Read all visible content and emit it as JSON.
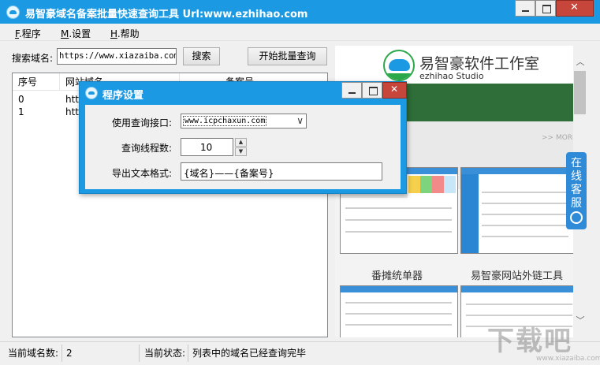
{
  "window": {
    "title": "易智豪域名备案批量快速查询工具 Url:www.ezhihao.com"
  },
  "menu": {
    "items": [
      {
        "key": "F",
        "label": ".程序"
      },
      {
        "key": "M",
        "label": ".设置"
      },
      {
        "key": "H",
        "label": ".帮助"
      }
    ]
  },
  "search": {
    "label": "搜索域名:",
    "value": "https://www.xiazaiba.com/",
    "search_button": "搜索",
    "batch_button": "开始批量查询"
  },
  "table": {
    "columns": [
      "序号",
      "网站域名",
      "备案号"
    ],
    "rows": [
      {
        "index": "0",
        "domain": "htt"
      },
      {
        "index": "1",
        "domain": "htt"
      }
    ]
  },
  "ad": {
    "brand_cn": "易智豪软件工作室",
    "brand_en": "ezhihao Studio",
    "more": ">> MORE",
    "caption_left": "番摊统单器",
    "caption_right": "易智豪网站外链工具"
  },
  "service_tab": {
    "chars": [
      "在",
      "线",
      "客",
      "服"
    ]
  },
  "dialog": {
    "title": "程序设置",
    "api_label": "使用查询接口:",
    "api_value": "www.icpchaxun.com",
    "threads_label": "查询线程数:",
    "threads_value": "10",
    "format_label": "导出文本格式:",
    "format_value": "{域名}——{备案号}"
  },
  "status": {
    "count_label": "当前域名数:",
    "count_value": "2",
    "state_label": "当前状态:",
    "state_value": "列表中的域名已经查询完毕"
  },
  "watermark": {
    "text": "下载吧",
    "url": "www.xiazaiba.com"
  },
  "colors": {
    "title_bar": "#1b9ae3",
    "close_button": "#c7463b",
    "ad_green": "#2f6e39",
    "service_tab": "#2f8bd8"
  }
}
